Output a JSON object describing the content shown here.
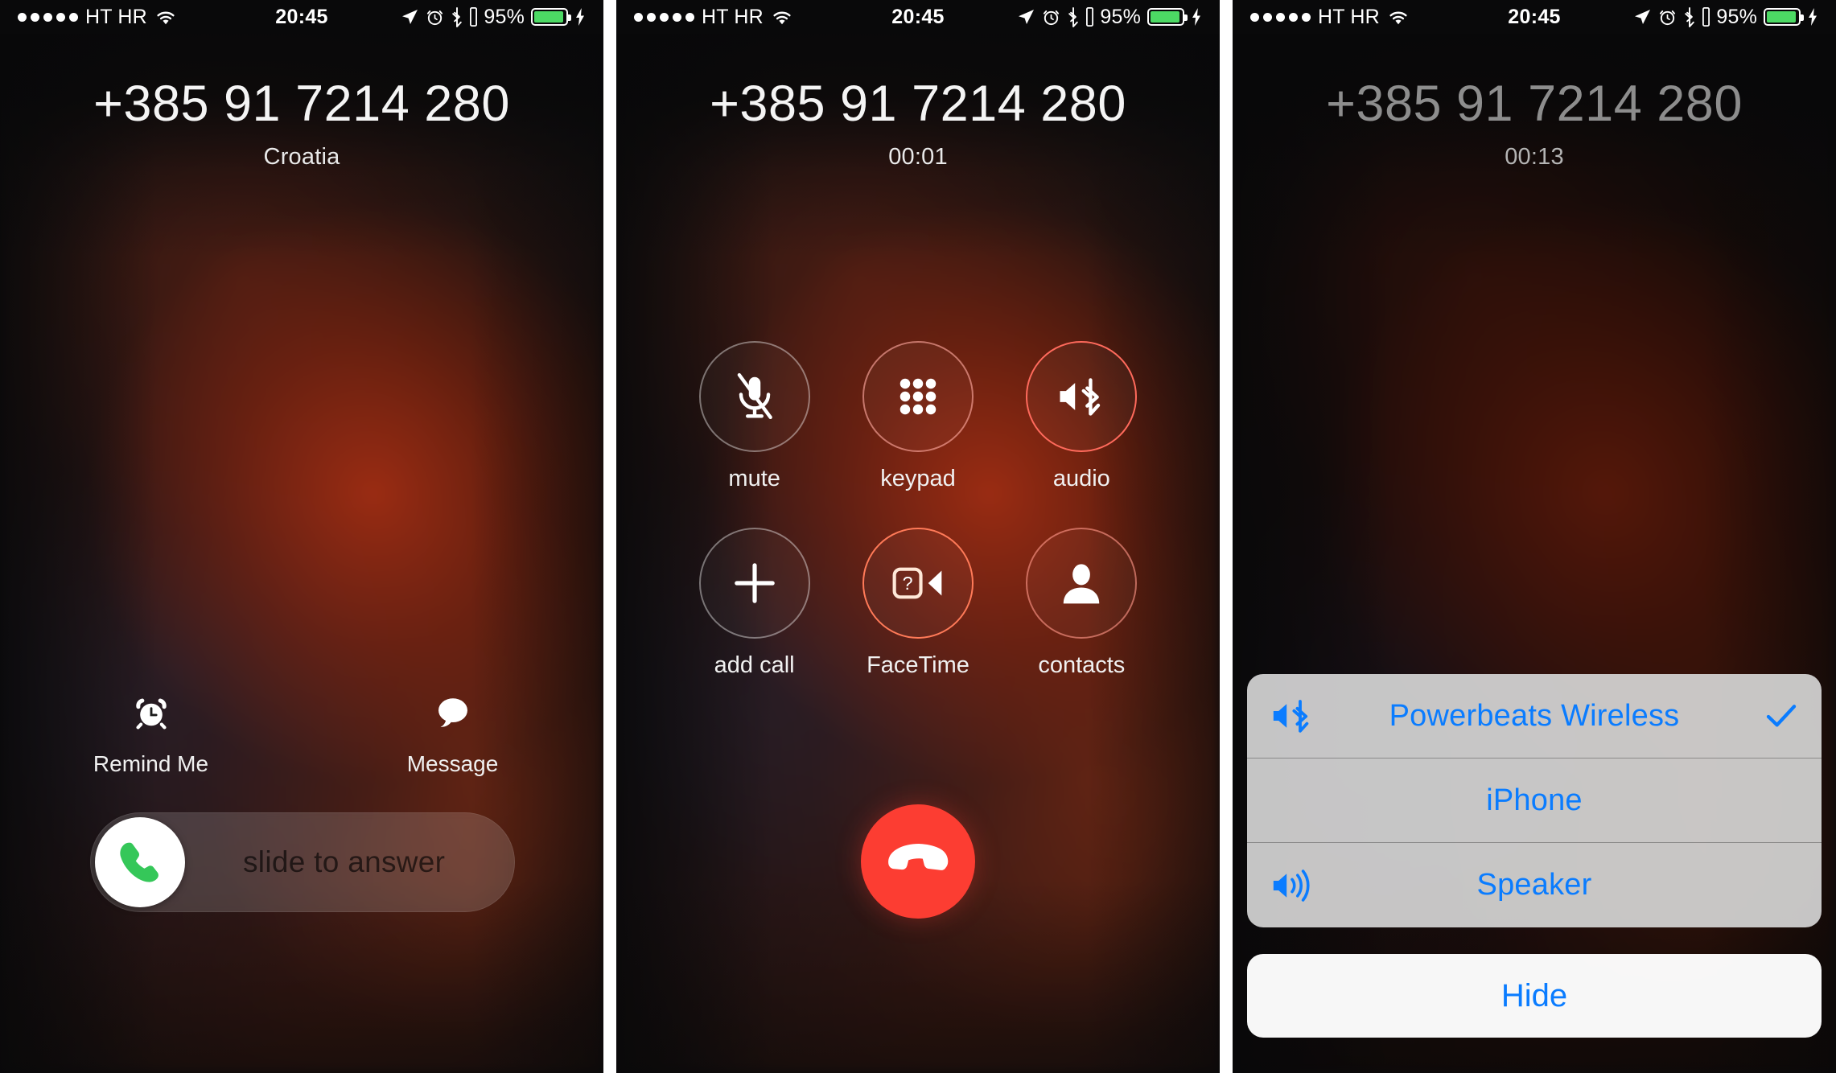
{
  "status_bar": {
    "signal_dots": 5,
    "carrier": "HT HR",
    "wifi_icon": "wifi-icon",
    "time": "20:45",
    "location_icon": "location-arrow-icon",
    "alarm_icon": "alarm-clock-icon",
    "bluetooth_icon": "bluetooth-icon",
    "battery_percent": "95%",
    "charging_icon": "lightning-bolt-icon"
  },
  "colors": {
    "accent_blue": "#0a7cff",
    "end_call_red": "#fc3d32",
    "answer_green": "#4cd964",
    "battery_green": "#4cd964",
    "audio_active_red": "#ff5a4d"
  },
  "panels": [
    {
      "id": "incoming-call",
      "phone_number": "+385 91 7214 280",
      "sub_label": "Croatia",
      "actions": [
        {
          "label": "Remind Me",
          "icon": "alarm-clock-icon"
        },
        {
          "label": "Message",
          "icon": "message-bubble-icon"
        }
      ],
      "slider": {
        "text": "slide to answer",
        "knob_icon": "phone-handset-icon"
      }
    },
    {
      "id": "in-call",
      "phone_number": "+385 91 7214 280",
      "sub_label": "00:01",
      "buttons": [
        {
          "label": "mute",
          "icon": "microphone-muted-icon",
          "active": false
        },
        {
          "label": "keypad",
          "icon": "keypad-dots-icon",
          "active": false
        },
        {
          "label": "audio",
          "icon": "speaker-bluetooth-icon",
          "active": true
        },
        {
          "label": "add call",
          "icon": "plus-icon",
          "active": false
        },
        {
          "label": "FaceTime",
          "icon": "facetime-video-icon",
          "active": true
        },
        {
          "label": "contacts",
          "icon": "contact-person-icon",
          "active": false
        }
      ],
      "end_call": {
        "label": "end call",
        "icon": "phone-hangup-icon"
      }
    },
    {
      "id": "audio-routes",
      "phone_number": "+385 91 7214 280",
      "sub_label": "00:13",
      "sheet_rows": [
        {
          "label": "Powerbeats Wireless",
          "lead_icon": "speaker-bluetooth-icon",
          "selected": true
        },
        {
          "label": "iPhone",
          "lead_icon": "",
          "selected": false
        },
        {
          "label": "Speaker",
          "lead_icon": "speaker-waves-icon",
          "selected": false
        }
      ],
      "hide_button": {
        "label": "Hide"
      }
    }
  ]
}
